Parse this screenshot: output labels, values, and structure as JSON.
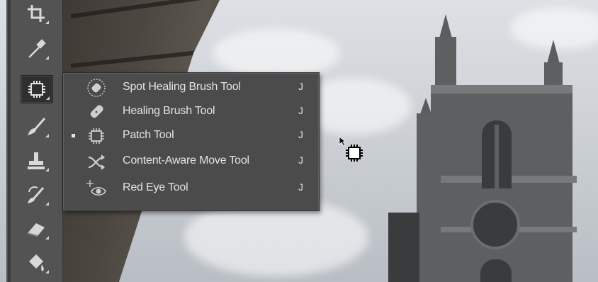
{
  "toolbar": {
    "tools": [
      {
        "icon": "crop-icon",
        "active": false
      },
      {
        "icon": "eyedropper-icon",
        "active": false
      },
      {
        "icon": "patch-icon",
        "active": true
      },
      {
        "icon": "brush-icon",
        "active": false
      },
      {
        "icon": "clone-stamp-icon",
        "active": false
      },
      {
        "icon": "history-brush-icon",
        "active": false
      },
      {
        "icon": "eraser-icon",
        "active": false
      },
      {
        "icon": "paint-bucket-icon",
        "active": false
      }
    ]
  },
  "flyout": {
    "items": [
      {
        "label": "Spot Healing Brush Tool",
        "shortcut": "J",
        "icon": "spot-healing-brush-icon",
        "selected": false
      },
      {
        "label": "Healing Brush Tool",
        "shortcut": "J",
        "icon": "healing-brush-icon",
        "selected": false
      },
      {
        "label": "Patch Tool",
        "shortcut": "J",
        "icon": "patch-icon",
        "selected": true
      },
      {
        "label": "Content-Aware Move Tool",
        "shortcut": "J",
        "icon": "content-aware-move-icon",
        "selected": false
      },
      {
        "label": "Red Eye Tool",
        "shortcut": "J",
        "icon": "red-eye-icon",
        "selected": false
      }
    ]
  },
  "colors": {
    "toolbar_bg": "#535353",
    "flyout_bg": "#4b4b4b",
    "text": "#e4e4e4"
  }
}
